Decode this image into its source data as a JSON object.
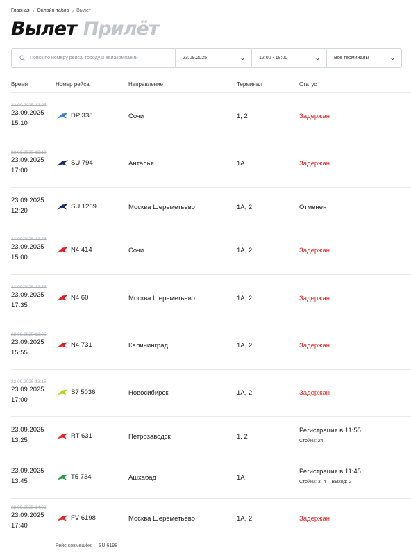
{
  "breadcrumb": [
    "Главная",
    "Онлайн-табло",
    "Вылет"
  ],
  "mode_tabs": [
    {
      "label": "Вылет",
      "active": true
    },
    {
      "label": "Прилёт",
      "active": false
    }
  ],
  "filters": {
    "search_placeholder": "Поиск по номеру рейса, городу и авиакомпании",
    "date": "23.09.2025",
    "time": "12:00 - 18:00",
    "terminal": "Все терминалы"
  },
  "columns": {
    "time": "Время",
    "flight": "Номер рейса",
    "direction": "Направление",
    "terminal": "Терминал",
    "status": "Статус"
  },
  "colors": {
    "delayed": "#e4211f",
    "divider": "#e7e9ec",
    "inactive_tab": "#c2c5c9"
  },
  "flights": [
    {
      "scheduled": "23.09.2025 12:05",
      "date": "23.09.2025",
      "time": "15:10",
      "airline_icon": "pobeda-logo-icon",
      "logo_color": "#3f7fd6",
      "flight": "DP 338",
      "direction": "Сочи",
      "terminal": "1, 2",
      "status": "Задержан",
      "status_type": "delayed"
    },
    {
      "scheduled": "23.09.2025 12:10",
      "date": "23.09.2025",
      "time": "17:00",
      "airline_icon": "aeroflot-logo-icon",
      "logo_color": "#1f2a6b",
      "flight": "SU 794",
      "direction": "Анталья",
      "terminal": "1A",
      "status": "Задержан",
      "status_type": "delayed"
    },
    {
      "scheduled": "",
      "date": "23.09.2025",
      "time": "12:20",
      "airline_icon": "aeroflot-logo-icon",
      "logo_color": "#1f2a6b",
      "flight": "SU 1269",
      "direction": "Москва Шереметьево",
      "terminal": "1A, 2",
      "status": "Отменен",
      "status_type": "normal"
    },
    {
      "scheduled": "23.09.2025 12:25",
      "date": "23.09.2025",
      "time": "15:00",
      "airline_icon": "nordwind-logo-icon",
      "logo_color": "#d3262b",
      "flight": "N4 414",
      "direction": "Сочи",
      "terminal": "1A, 2",
      "status": "Задержан",
      "status_type": "delayed"
    },
    {
      "scheduled": "23.09.2025 12:35",
      "date": "23.09.2025",
      "time": "17:35",
      "airline_icon": "nordwind-logo-icon",
      "logo_color": "#d3262b",
      "flight": "N4 60",
      "direction": "Москва Шереметьево",
      "terminal": "1A, 2",
      "status": "Задержан",
      "status_type": "delayed"
    },
    {
      "scheduled": "23.09.2025 13:05",
      "date": "23.09.2025",
      "time": "15:55",
      "airline_icon": "nordwind-logo-icon",
      "logo_color": "#d3262b",
      "flight": "N4 731",
      "direction": "Калининград",
      "terminal": "1A, 2",
      "status": "Задержан",
      "status_type": "delayed"
    },
    {
      "scheduled": "23.09.2025 13:15",
      "date": "23.09.2025",
      "time": "17:00",
      "airline_icon": "s7-logo-icon",
      "logo_color": "#b7d12b",
      "flight": "S7 5036",
      "direction": "Новосибирск",
      "terminal": "1A, 2",
      "status": "Задержан",
      "status_type": "delayed"
    },
    {
      "scheduled": "",
      "date": "23.09.2025",
      "time": "13:25",
      "airline_icon": "nordstar-logo-icon",
      "logo_color": "#e2272d",
      "flight": "RT 631",
      "direction": "Петрозаводск",
      "terminal": "1, 2",
      "status": "Регистрация в 11:55",
      "status_type": "normal",
      "status_detail": [
        "Стойки: 24"
      ]
    },
    {
      "scheduled": "",
      "date": "23.09.2025",
      "time": "13:45",
      "airline_icon": "turkmenistan-logo-icon",
      "logo_color": "#2e9a4f",
      "flight": "T5 734",
      "direction": "Ашхабад",
      "terminal": "1A",
      "status": "Регистрация в 11:45",
      "status_type": "normal",
      "status_detail": [
        "Стойки: 3, 4",
        "Выход: 2"
      ]
    },
    {
      "scheduled": "23.09.2025 14:00",
      "date": "23.09.2025",
      "time": "17:40",
      "airline_icon": "rossiya-logo-icon",
      "logo_color": "#d92e2e",
      "flight": "FV 6198",
      "direction": "Москва Шереметьево",
      "terminal": "1A, 2",
      "status": "Задержан",
      "status_type": "delayed"
    }
  ],
  "codeshare": {
    "label": "Рейс совмещён:",
    "flight": "SU 6198"
  }
}
